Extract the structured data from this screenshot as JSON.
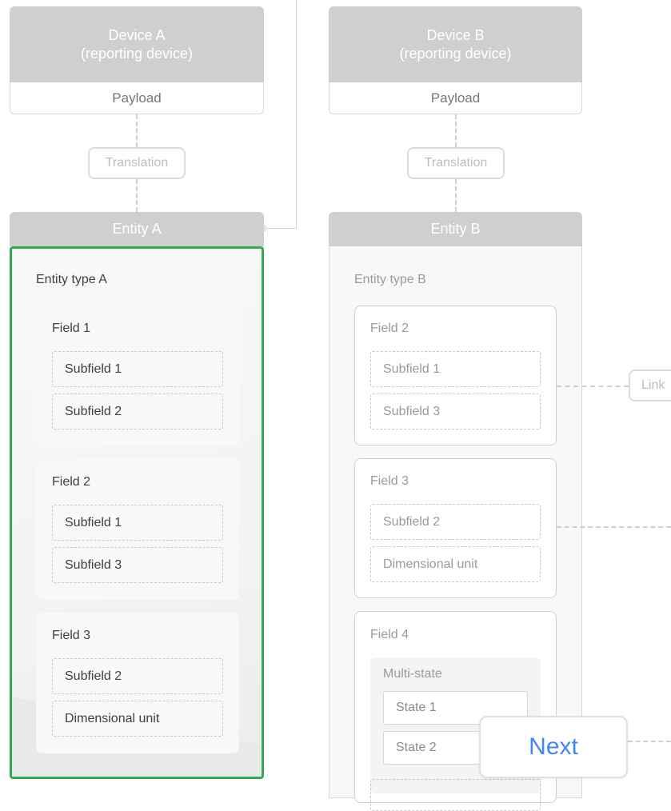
{
  "device_a": {
    "title_line1": "Device A",
    "title_line2": "(reporting device)",
    "payload": "Payload",
    "translation": "Translation"
  },
  "device_b": {
    "title_line1": "Device B",
    "title_line2": "(reporting device)",
    "payload": "Payload",
    "translation": "Translation"
  },
  "entity_a": {
    "header": "Entity A",
    "type": "Entity type A",
    "fields": [
      {
        "label": "Field 1",
        "subfields": [
          "Subfield 1",
          "Subfield 2"
        ]
      },
      {
        "label": "Field 2",
        "subfields": [
          "Subfield 1",
          "Subfield 3"
        ]
      },
      {
        "label": "Field 3",
        "subfields": [
          "Subfield 2",
          "Dimensional unit"
        ]
      }
    ]
  },
  "entity_b": {
    "header": "Entity B",
    "type": "Entity type B",
    "fields": [
      {
        "label": "Field 2",
        "subfields": [
          "Subfield 1",
          "Subfield 3"
        ]
      },
      {
        "label": "Field 3",
        "subfields": [
          "Subfield 2",
          "Dimensional unit"
        ]
      },
      {
        "label": "Field 4",
        "multistate_label": "Multi-state",
        "states": [
          "State 1",
          "State 2"
        ]
      }
    ]
  },
  "link_label": "Link",
  "next_button": "Next",
  "colors": {
    "highlight_border": "#34a853",
    "next_text": "#4285f4",
    "header_gray": "#cfcfcf"
  }
}
